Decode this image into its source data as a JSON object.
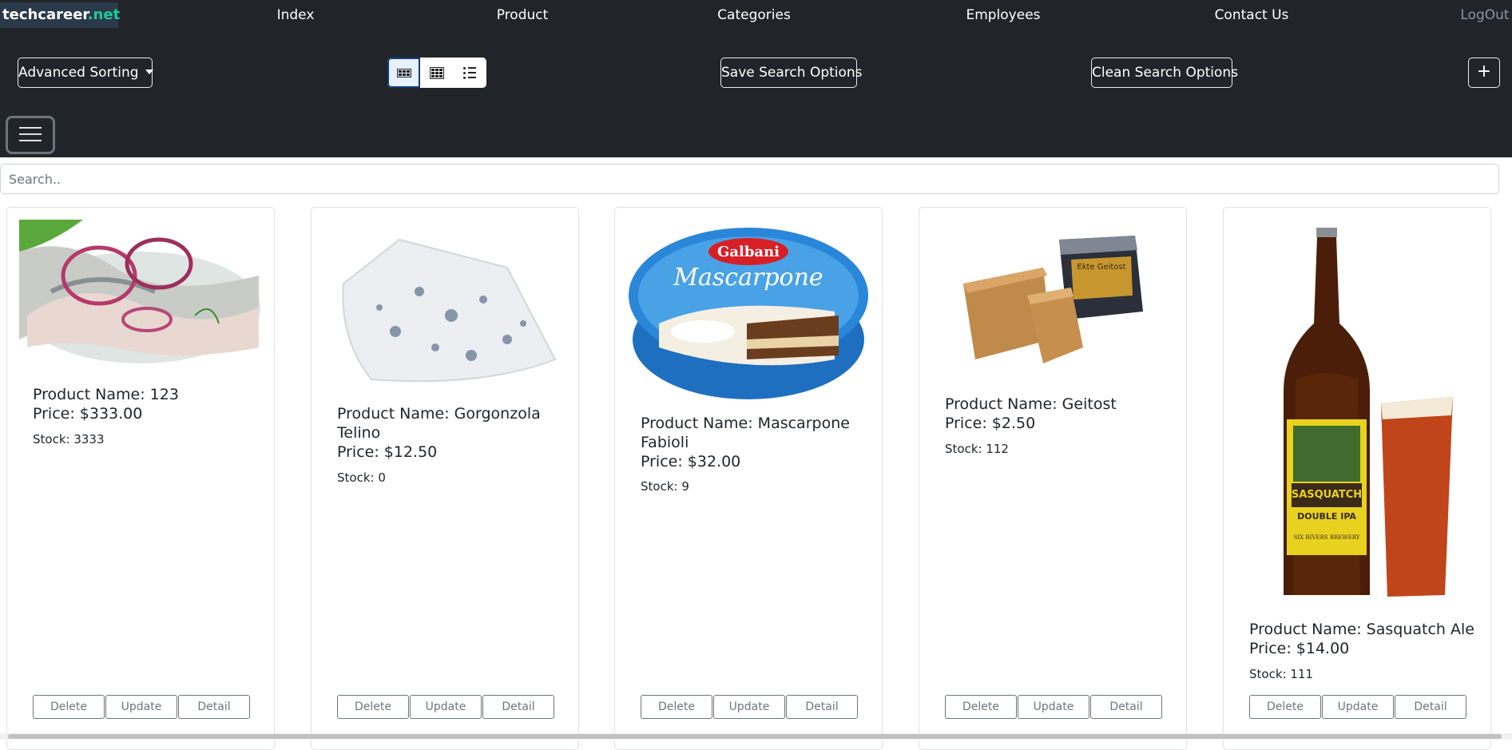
{
  "brand": {
    "part1": "techcareer",
    "part2": ".net"
  },
  "nav": {
    "index": "Index",
    "product": "Product",
    "categories": "Categories",
    "employees": "Employees",
    "contact": "Contact Us",
    "logout": "LogOut"
  },
  "toolbar": {
    "advanced_sorting": "Advanced Sorting",
    "save_search": "Save Search Options",
    "clean_search": "Clean Search Options",
    "add": "+",
    "view_modes": [
      "grid-large",
      "grid-small",
      "list"
    ],
    "active_view": "grid-large"
  },
  "search": {
    "placeholder": "Search..",
    "value": ""
  },
  "products": [
    {
      "name": "Product Name: 123",
      "price": "Price: $333.00",
      "stock": "Stock: 3333"
    },
    {
      "name": "Product Name: Gorgonzola Telino",
      "price": "Price: $12.50",
      "stock": "Stock: 0"
    },
    {
      "name": "Product Name: Mascarpone Fabioli",
      "price": "Price: $32.00",
      "stock": "Stock: 9"
    },
    {
      "name": "Product Name: Geitost",
      "price": "Price: $2.50",
      "stock": "Stock: 112"
    },
    {
      "name": "Product Name: Sasquatch Ale",
      "price": "Price: $14.00",
      "stock": "Stock: 111"
    }
  ],
  "card_buttons": {
    "delete": "Delete",
    "update": "Update",
    "detail": "Detail"
  },
  "image_text": {
    "galbani": "Galbani",
    "mascarpone": "Mascarpone",
    "sasquatch": "SASQUATCH",
    "double_ipa": "DOUBLE IPA",
    "brewery": "SIX RIVERS BREWERY",
    "geitost": "Ekte Geitost"
  }
}
